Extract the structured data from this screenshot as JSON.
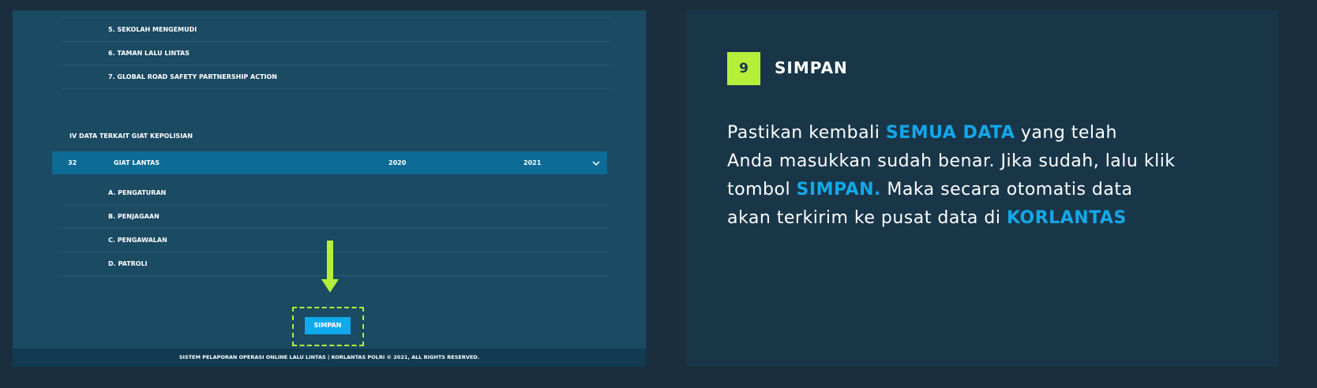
{
  "left": {
    "rows_top": [
      "5. SEKOLAH MENGEMUDI",
      "6. TAMAN LALU LINTAS",
      "7. GLOBAL ROAD SAFETY PARTNERSHIP ACTION"
    ],
    "section_title": "IV DATA TERKAIT GIAT KEPOLISIAN",
    "table_header": {
      "number": "32",
      "label": "GIAT LANTAS",
      "col1": "2020",
      "col2": "2021"
    },
    "rows_bottom": [
      "A. PENGATURAN",
      "B. PENJAGAAN",
      "C. PENGAWALAN",
      "D. PATROLI"
    ],
    "button_label": "SIMPAN",
    "footer": "SISTEM PELAPORAN OPERASI ONLINE LALU LINTAS | KORLANTAS POLRI © 2021, ALL RIGHTS RESERVED."
  },
  "right": {
    "step_number": "9",
    "step_title": "SIMPAN",
    "description": {
      "line1_a": "Pastikan kembali ",
      "line1_hl": "SEMUA DATA",
      "line1_b": " yang telah",
      "line2": "Anda masukkan sudah benar. Jika sudah, lalu klik",
      "line3_a": "tombol ",
      "line3_hl": "SIMPAN.",
      "line3_b": " Maka secara otomatis data",
      "line4_a": "akan terkirim ke pusat data di ",
      "line4_hl": "KORLANTAS"
    }
  },
  "colors": {
    "accent_green": "#b5ef3a",
    "accent_blue": "#12a8ea",
    "page_bg": "#1b2e3d",
    "left_panel_bg": "#1b4a63",
    "right_panel_bg": "#193649",
    "header_bg": "#0e6b96"
  },
  "icons": {
    "header_toggle": "chevron-down-icon",
    "pointer": "arrow-down-icon"
  }
}
